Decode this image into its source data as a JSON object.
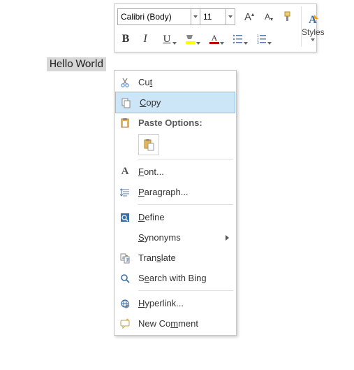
{
  "toolbar": {
    "font_name": "Calibri (Body)",
    "font_size": "11",
    "bold": "B",
    "italic": "I",
    "underline": "U",
    "increase_font": "A",
    "decrease_font": "A",
    "styles_label": "Styles"
  },
  "document": {
    "selected_text": "Hello World"
  },
  "context_menu": {
    "cut": {
      "label": "Cut",
      "accel": "t"
    },
    "copy": {
      "label": "Copy",
      "accel": "C"
    },
    "paste_options": {
      "label": "Paste Options:"
    },
    "font": {
      "label": "Font...",
      "accel": "F"
    },
    "paragraph": {
      "label": "Paragraph...",
      "accel": "P"
    },
    "define": {
      "label": "Define",
      "accel": "D"
    },
    "synonyms": {
      "label": "Synonyms",
      "accel": "S"
    },
    "translate": {
      "label": "Translate",
      "accel": "s"
    },
    "search_bing": {
      "label": "Search with Bing",
      "accel": "e"
    },
    "hyperlink": {
      "label": "Hyperlink...",
      "accel": "H"
    },
    "new_comment": {
      "label": "New Comment",
      "accel": "m"
    }
  }
}
